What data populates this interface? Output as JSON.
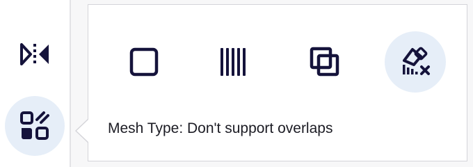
{
  "toolbar": {
    "tools": [
      {
        "icon": "mirror-icon",
        "active": false
      },
      {
        "icon": "mesh-type-icon",
        "active": true
      }
    ]
  },
  "mesh_type_popover": {
    "options": [
      {
        "icon": "square-mesh-icon",
        "selected": false
      },
      {
        "icon": "vertical-bars-mesh-icon",
        "selected": false
      },
      {
        "icon": "overlapping-squares-icon",
        "selected": false
      },
      {
        "icon": "no-overlap-mesh-icon",
        "selected": true
      }
    ],
    "caption": "Mesh Type: Don't support overlaps"
  },
  "colors": {
    "icon": "#15133b",
    "selected_bg": "#e6eef8",
    "border": "#d4d4d9"
  }
}
